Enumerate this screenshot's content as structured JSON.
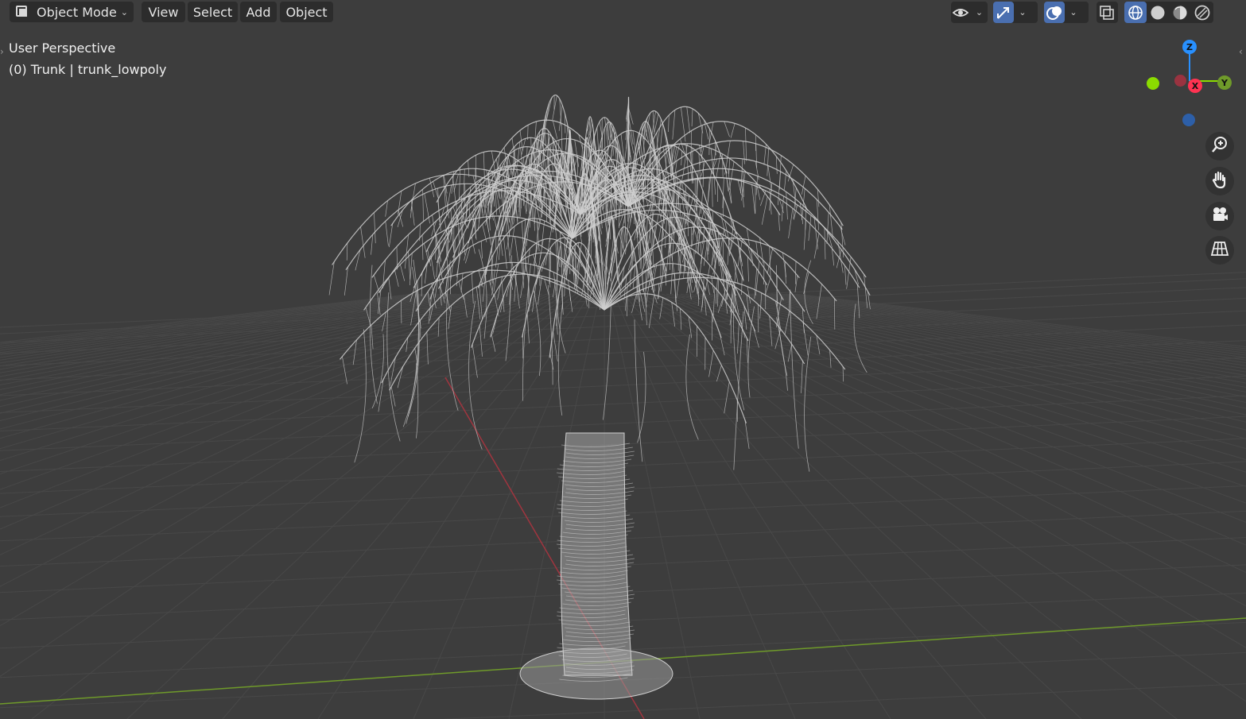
{
  "header": {
    "mode": "Object Mode",
    "menus": [
      "View",
      "Select",
      "Add",
      "Object"
    ]
  },
  "viewport": {
    "perspective_label": "User Perspective",
    "object_label": "(0) Trunk | trunk_lowpoly",
    "shading_mode": "wireframe"
  },
  "gizmo": {
    "x_label": "X",
    "y_label": "Y",
    "z_label": "Z",
    "colors": {
      "x": "#ff3352",
      "y": "#8bdc00",
      "z": "#2890ff"
    }
  },
  "toolbar_right": {
    "icons": [
      "visibility-icon",
      "gizmo-toggle-icon",
      "overlay-toggle-icon",
      "xray-icon",
      "wireframe-shading-icon",
      "solid-shading-icon",
      "material-shading-icon",
      "rendered-shading-icon"
    ]
  },
  "nav_buttons": [
    "zoom-icon",
    "pan-hand-icon",
    "camera-view-icon",
    "ortho-grid-icon"
  ],
  "colors": {
    "background": "#3d3d3d",
    "grid": "#484848",
    "wire": "#cfcfcf",
    "x_axis": "#a0353f",
    "y_axis": "#6f9a2a",
    "accent": "#4a6fb0"
  }
}
